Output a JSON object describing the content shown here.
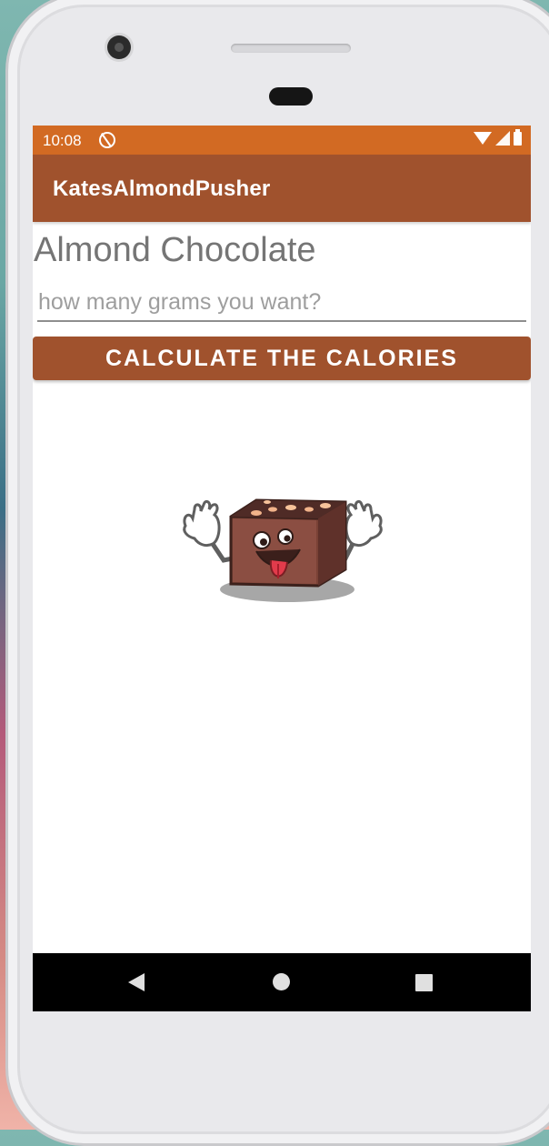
{
  "status_bar": {
    "time": "10:08"
  },
  "app_bar": {
    "title": "KatesAlmondPusher"
  },
  "main": {
    "heading": "Almond Chocolate",
    "grams_input": {
      "value": "",
      "placeholder": "how many grams you want?"
    },
    "calculate_button_label": "CALCULATE THE CALORIES",
    "image": "chocolate-mascot"
  },
  "colors": {
    "status_bar": "#d26a23",
    "primary": "#a0522d",
    "background": "#ffffff",
    "heading_text": "#757575"
  },
  "icons": {
    "status": [
      "app-notification-icon",
      "wifi-icon",
      "signal-icon",
      "battery-icon"
    ],
    "nav": [
      "back-icon",
      "home-icon",
      "recents-icon"
    ]
  }
}
